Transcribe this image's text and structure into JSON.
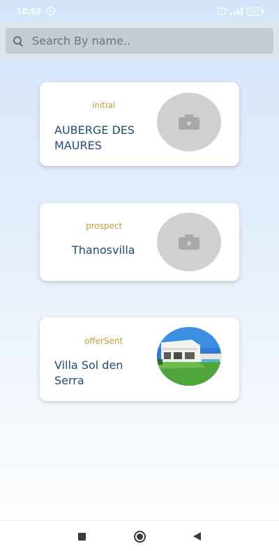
{
  "status_bar": {
    "time": "10:53",
    "battery": "82"
  },
  "search": {
    "placeholder": "Search By name..",
    "value": ""
  },
  "cards": [
    {
      "status": "initial",
      "name_line1": "AUBERGE DES",
      "name_line2": "MAURES",
      "photo": "camera-placeholder-icon"
    },
    {
      "status": "prospect",
      "name_line1": "Thanosvilla",
      "name_line2": "",
      "photo": "camera-placeholder-icon"
    },
    {
      "status": "offerSent",
      "name_line1": "Villa Sol den",
      "name_line2": "Serra",
      "photo": "villa-photo"
    }
  ],
  "colors": {
    "status_text": "#c99a3a",
    "name_text": "#1f4c7a",
    "card_bg": "#ffffff",
    "search_bg": "#c4cbd4"
  },
  "nav": {
    "icons": [
      "square-recent-apps-icon",
      "circle-home-icon",
      "triangle-back-icon"
    ]
  }
}
